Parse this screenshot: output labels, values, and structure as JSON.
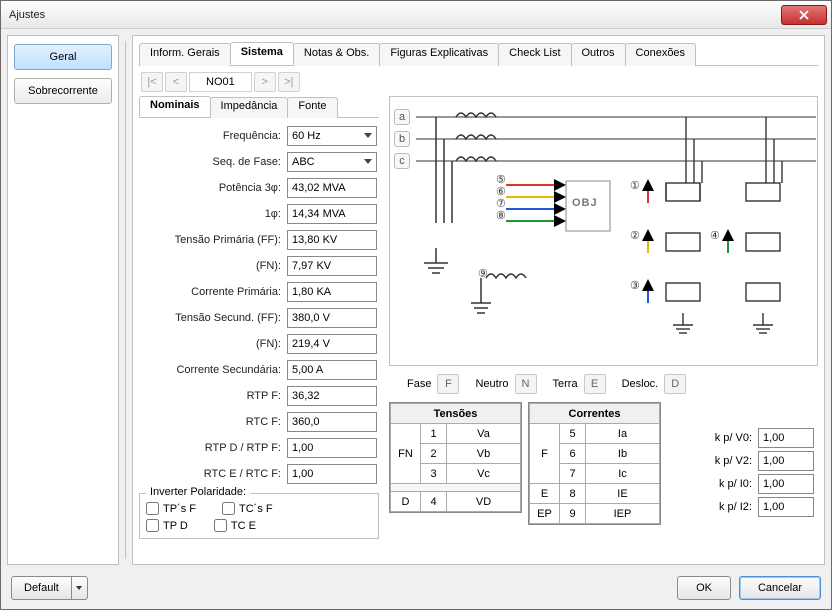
{
  "window": {
    "title": "Ajustes"
  },
  "side": {
    "geral": "Geral",
    "sobrecor": "Sobrecorrente"
  },
  "maintabs": {
    "inform": "Inform. Gerais",
    "sistema": "Sistema",
    "notas": "Notas & Obs.",
    "figuras": "Figuras Explicativas",
    "checklist": "Check List",
    "outros": "Outros",
    "conex": "Conexões"
  },
  "nav": {
    "node": "NO01"
  },
  "subtabs": {
    "nominais": "Nominais",
    "imped": "Impedância",
    "fonte": "Fonte"
  },
  "form": {
    "freq_l": "Frequência:",
    "freq_v": "60 Hz",
    "seq_l": "Seq. de Fase:",
    "seq_v": "ABC",
    "pot3_l": "Potência 3φ:",
    "pot3_v": "43,02 MVA",
    "pot1_l": "1φ:",
    "pot1_v": "14,34 MVA",
    "tpff_l": "Tensão Primária (FF):",
    "tpff_v": "13,80 KV",
    "tpfn_l": "(FN):",
    "tpfn_v": "7,97 KV",
    "cp_l": "Corrente Primária:",
    "cp_v": "1,80 KA",
    "tsff_l": "Tensão Secund. (FF):",
    "tsff_v": "380,0 V",
    "tsfn_l": "(FN):",
    "tsfn_v": "219,4 V",
    "cs_l": "Corrente Secundária:",
    "cs_v": "5,00 A",
    "rtpf_l": "RTP F:",
    "rtpf_v": "36,32",
    "rtcf_l": "RTC F:",
    "rtcf_v": "360,0",
    "rtpd_l": "RTP D / RTP F:",
    "rtpd_v": "1,00",
    "rtce_l": "RTC E / RTC F:",
    "rtce_v": "1,00"
  },
  "invert": {
    "legend": "Inverter Polaridade:",
    "tpsf": "TP´s F",
    "tcsf": "TC´s F",
    "tpd": "TP D",
    "tce": "TC E"
  },
  "legendrow": {
    "fase": "Fase",
    "f": "F",
    "neutro": "Neutro",
    "n": "N",
    "terra": "Terra",
    "e": "E",
    "desloc": "Desloc.",
    "d": "D"
  },
  "tensoes": {
    "title": "Tensões",
    "fn": "FN",
    "d": "D",
    "r1n": "1",
    "r1v": "Va",
    "r2n": "2",
    "r2v": "Vb",
    "r3n": "3",
    "r3v": "Vc",
    "r4n": "4",
    "r4v": "VD"
  },
  "correntes": {
    "title": "Correntes",
    "f": "F",
    "e": "E",
    "ep": "EP",
    "r5n": "5",
    "r5v": "Ia",
    "r6n": "6",
    "r6v": "Ib",
    "r7n": "7",
    "r7v": "Ic",
    "r8n": "8",
    "r8v": "IE",
    "r9n": "9",
    "r9v": "IEP"
  },
  "kfactors": {
    "v0_l": "k p/ V0:",
    "v0_v": "1,00",
    "v2_l": "k p/ V2:",
    "v2_v": "1,00",
    "i0_l": "k p/ I0:",
    "i0_v": "1,00",
    "i2_l": "k p/ I2:",
    "i2_v": "1,00"
  },
  "diagram": {
    "obj": "OBJ",
    "a": "a",
    "b": "b",
    "c": "c",
    "n1": "①",
    "n2": "②",
    "n3": "③",
    "n4": "④",
    "n5": "⑤",
    "n6": "⑥",
    "n7": "⑦",
    "n8": "⑧",
    "n9": "⑨"
  },
  "footer": {
    "default": "Default",
    "ok": "OK",
    "cancel": "Cancelar"
  }
}
